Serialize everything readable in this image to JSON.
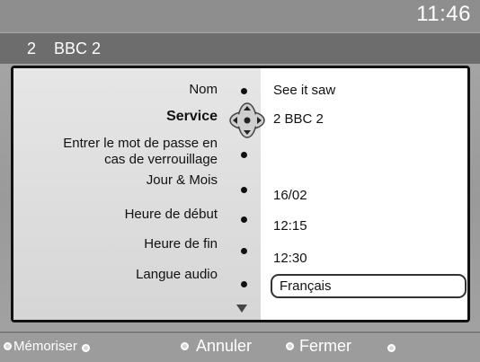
{
  "header": {
    "clock": "11:46"
  },
  "channel": {
    "number": "2",
    "name": "BBC 2"
  },
  "form": {
    "rows": [
      {
        "label": "Nom",
        "value": "See it saw"
      },
      {
        "label": "Service",
        "value": "2 BBC 2"
      },
      {
        "label_line1": "Entrer le mot de passe en",
        "label_line2": "cas de verrouillage",
        "value": ""
      },
      {
        "label": "Jour & Mois",
        "value": "16/02"
      },
      {
        "label": "Heure de début",
        "value": "12:15"
      },
      {
        "label": "Heure de fin",
        "value": "12:30"
      },
      {
        "label": "Langue audio",
        "value": "Français"
      }
    ]
  },
  "footer": {
    "memoriser": "Mémoriser",
    "annuler": "Annuler",
    "fermer": "Fermer"
  },
  "icons": {
    "joypad": "navigation-cross-icon",
    "more": "down-triangle-icon",
    "color_keys": "remote-color-key-icon"
  }
}
